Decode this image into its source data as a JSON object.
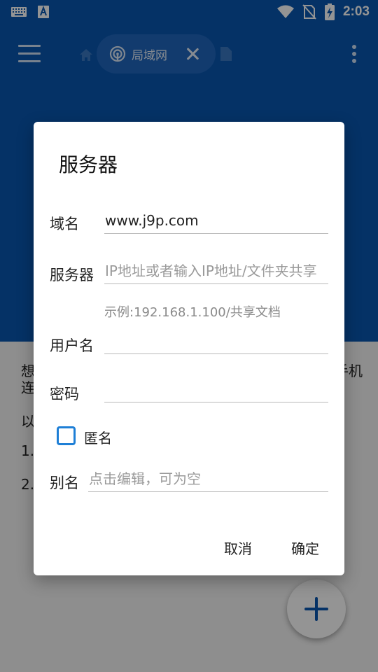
{
  "status_bar": {
    "time": "2:03",
    "icons": [
      "keyboard-icon",
      "text-a-icon",
      "wifi-icon",
      "no-sim-icon",
      "battery-charging-icon"
    ]
  },
  "app_bar": {
    "tab_label": "局域网",
    "icons": [
      "menu-icon",
      "home-icon",
      "network-icon",
      "close-icon",
      "document-icon",
      "more-vert-icon"
    ]
  },
  "background_content": {
    "line1_start": "想",
    "line1_end": "手机",
    "line2_start": "连",
    "line3_start": "以",
    "item1_start": "1.",
    "item2_start": "2."
  },
  "dialog": {
    "title": "服务器",
    "domain": {
      "label": "域名",
      "value": "www.j9p.com"
    },
    "server": {
      "label": "服务器",
      "placeholder": "IP地址或者输入IP地址/文件夹共享"
    },
    "server_hint": "示例:192.168.1.100/共享文档",
    "username": {
      "label": "用户名",
      "value": ""
    },
    "password": {
      "label": "密码",
      "value": ""
    },
    "anonymous": {
      "label": "匿名",
      "checked": false
    },
    "alias": {
      "label": "别名",
      "placeholder": "点击编辑，可为空"
    },
    "cancel_label": "取消",
    "confirm_label": "确定"
  },
  "colors": {
    "primary": "#0a57b0",
    "accent": "#1e7fd6",
    "scrim": "rgba(0,0,0,0.42)"
  }
}
